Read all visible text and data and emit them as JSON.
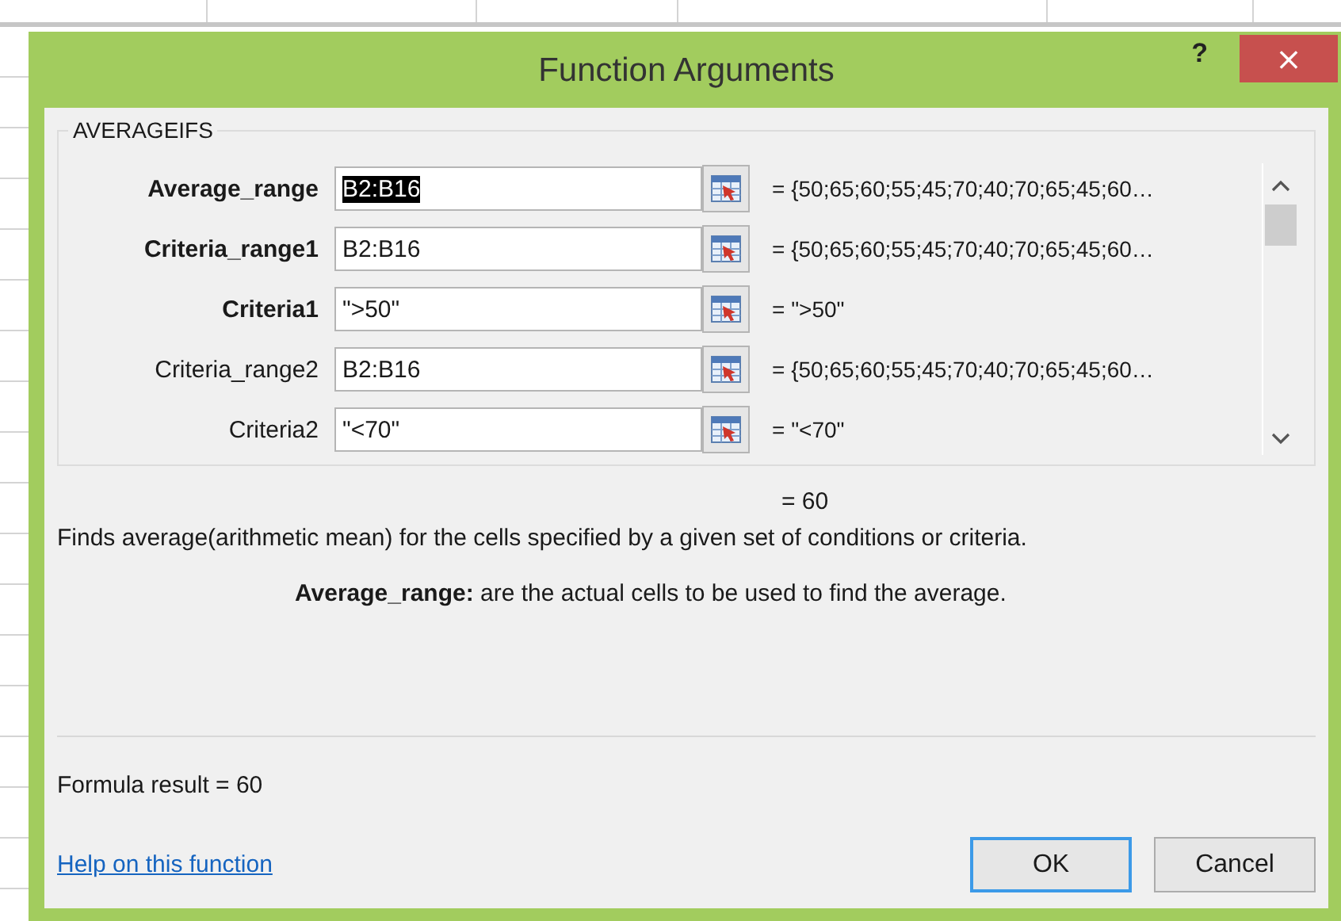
{
  "window": {
    "title": "Function Arguments",
    "help": "?",
    "close": "×"
  },
  "function_name": "AVERAGEIFS",
  "arguments": [
    {
      "label": "Average_range",
      "required": true,
      "value": "B2:B16",
      "selected": true,
      "result": "=  {50;65;60;55;45;70;40;70;65;45;60…"
    },
    {
      "label": "Criteria_range1",
      "required": true,
      "value": "B2:B16",
      "selected": false,
      "result": "=  {50;65;60;55;45;70;40;70;65;45;60…"
    },
    {
      "label": "Criteria1",
      "required": true,
      "value": "\">50\"",
      "selected": false,
      "result": "=  \">50\""
    },
    {
      "label": "Criteria_range2",
      "required": false,
      "value": "B2:B16",
      "selected": false,
      "result": "=  {50;65;60;55;45;70;40;70;65;45;60…"
    },
    {
      "label": "Criteria2",
      "required": false,
      "value": "\"<70\"",
      "selected": false,
      "result": "=  \"<70\""
    }
  ],
  "function_result": "=  60",
  "description": "Finds average(arithmetic mean) for the cells specified by a given set of conditions or criteria.",
  "argument_help": "**Average_range:**  are the actual cells to be used to find the average.",
  "formula_result": "Formula result =   60",
  "help_link": "Help on this function",
  "buttons": [
    {
      "label": "OK",
      "default": true
    },
    {
      "label": "Cancel",
      "default": false
    }
  ]
}
